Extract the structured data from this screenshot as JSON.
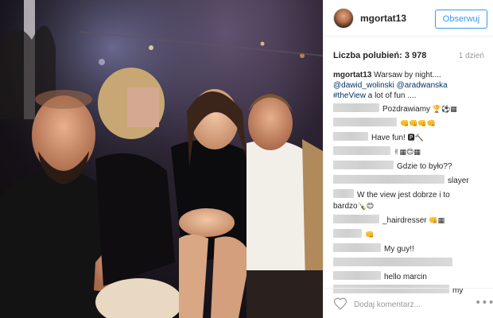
{
  "post": {
    "username": "mgortat13",
    "follow_label": "Obserwuj",
    "likes_text": "Liczba polubień: 3 978",
    "time_ago": "1 dzień",
    "caption": {
      "user": "mgortat13",
      "line1": "Warsaw by night....",
      "line2_a": "@dawid_wolinski",
      "line2_b": "@aradwanska",
      "line3_tag": "#theView",
      "line3_rest": "a lot of fun ...."
    },
    "comments": [
      {
        "text": "Pozdrawiamy",
        "emoji": "🏆⚽▦"
      },
      {
        "text": "",
        "emoji": "👊👊👊👊"
      },
      {
        "text": "Have fun! ",
        "emoji": "🅿🔨"
      },
      {
        "text": "",
        "emoji": "✌▦😊▦"
      },
      {
        "text": "Gdzie to było??",
        "emoji": ""
      },
      {
        "text": "slayer",
        "emoji": ""
      },
      {
        "text": "W the view jest dobrze i to",
        "emoji": ""
      },
      {
        "text": "bardzo",
        "emoji": "🍾😊"
      },
      {
        "text": "_hairdresser ",
        "emoji": "👊▦"
      },
      {
        "text": "",
        "emoji": "👊"
      },
      {
        "text": "My guy!!",
        "emoji": ""
      },
      {
        "text": "",
        "emoji": ""
      },
      {
        "text": "hello marcin",
        "emoji": ""
      },
      {
        "text": "my",
        "emoji": ""
      }
    ],
    "comment_placeholder": "Dodaj komentarz...",
    "more_icon": "•••"
  },
  "colors": {
    "accent": "#3897f0",
    "text": "#262626",
    "muted": "#999999"
  }
}
